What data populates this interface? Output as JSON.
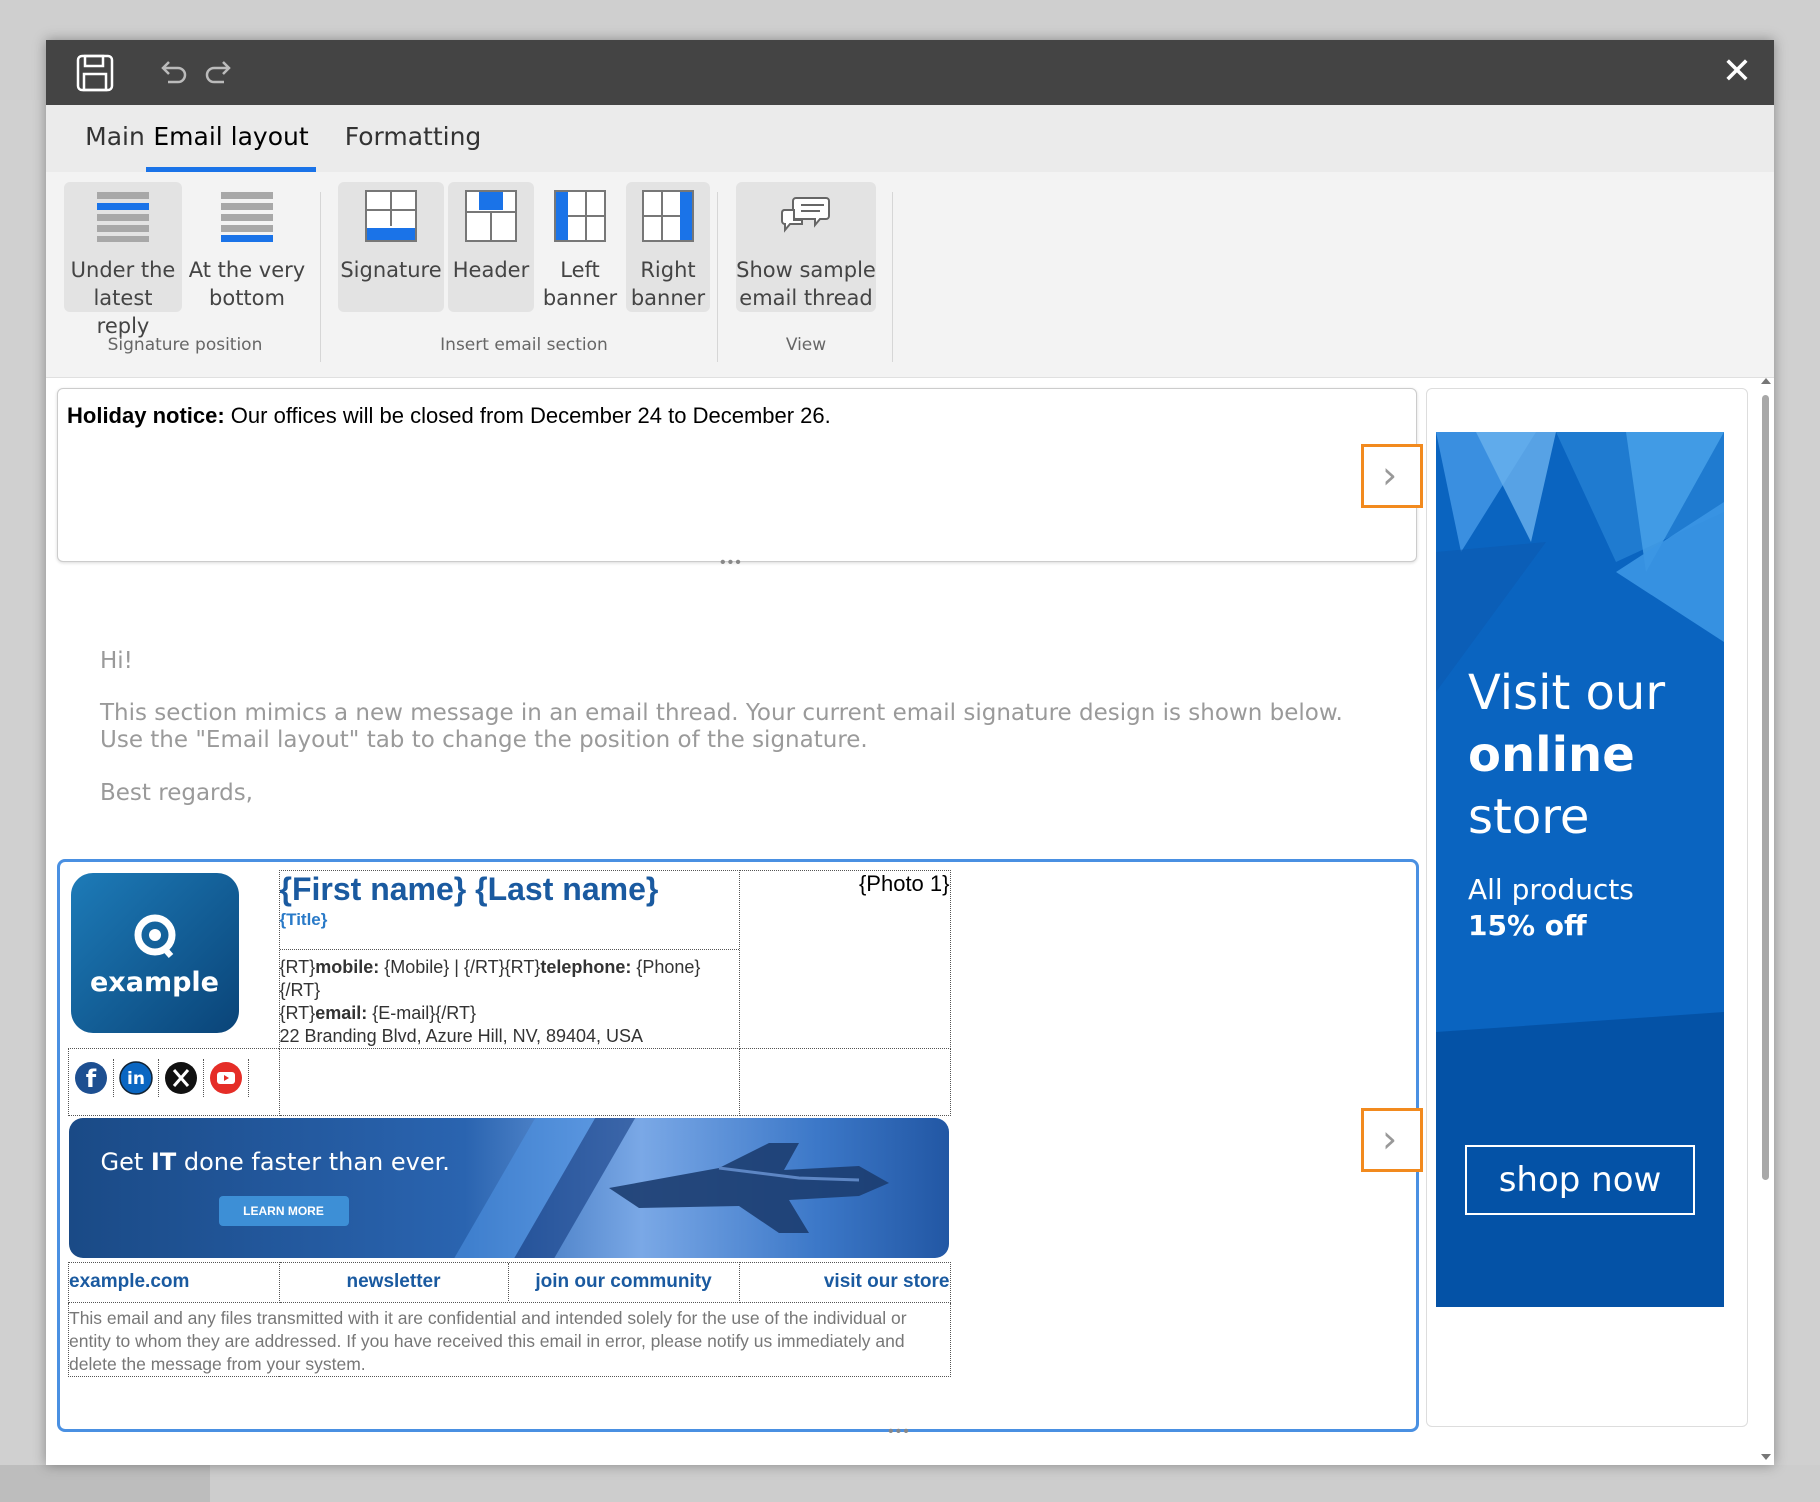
{
  "tabs": [
    {
      "label": "Main",
      "active": false
    },
    {
      "label": "Email layout",
      "active": true
    },
    {
      "label": "Formatting",
      "active": false
    }
  ],
  "ribbon": {
    "signature_position": {
      "label": "Signature position",
      "buttons": [
        {
          "label": "Under the\nlatest reply",
          "icon": "under-latest-reply-icon"
        },
        {
          "label": "At the very\nbottom",
          "icon": "very-bottom-icon"
        }
      ]
    },
    "insert_email_section": {
      "label": "Insert email section",
      "buttons": [
        {
          "label": "Signature",
          "icon": "signature-section-icon"
        },
        {
          "label": "Header",
          "icon": "header-section-icon"
        },
        {
          "label": "Left\nbanner",
          "icon": "left-banner-icon"
        },
        {
          "label": "Right\nbanner",
          "icon": "right-banner-icon"
        }
      ]
    },
    "view": {
      "label": "View",
      "buttons": [
        {
          "label": "Show sample\nemail thread",
          "icon": "chat-bubbles-icon"
        }
      ]
    }
  },
  "notice": {
    "bold": "Holiday notice:",
    "text": " Our offices will be closed from December 24 to December 26."
  },
  "message": {
    "greeting": "Hi!",
    "body": "This section mimics a new message in an email thread. Your current email signature design is shown below. Use the \"Email layout\" tab to change the position of the signature.",
    "closing": "Best regards,"
  },
  "signature": {
    "logo_text": "example",
    "name": "{First name} {Last name}",
    "title": "{Title}",
    "photo": "{Photo 1}",
    "contact": {
      "line1_pre": "{RT}",
      "mobile_label": "mobile:",
      "mobile_val": " {Mobile}  |  {/RT}{RT}",
      "phone_label": "telephone:",
      "phone_val": " {Phone}",
      "line2": "{/RT}",
      "line3_pre": "{RT}",
      "email_label": "email:",
      "email_val": " {E-mail}{/RT}",
      "address": "22 Branding Blvd, Azure Hill, NV, 89404, USA"
    },
    "banner": {
      "headline_pre": "Get ",
      "headline_bold": "IT",
      "headline_post": " done faster than ever.",
      "button": "LEARN MORE"
    },
    "links": [
      "example.com",
      "newsletter",
      "join our community",
      "visit our store"
    ],
    "disclaimer": "This email and any files transmitted with it are confidential and intended solely for the use of the individual or entity to whom they are addressed. If you have received this email in error, please notify us immediately and delete the message from your system."
  },
  "right_banner": {
    "line1": "Visit our",
    "line2": "online",
    "line3": "store",
    "sub1": "All products",
    "sub2": "15% off",
    "cta": "shop now"
  },
  "colors": {
    "accent": "#1a73e8",
    "title_bar": "#444444",
    "signature_blue": "#1a5aa0",
    "ad_blue": "#0a64c0",
    "highlight_orange": "#f28a1e"
  }
}
